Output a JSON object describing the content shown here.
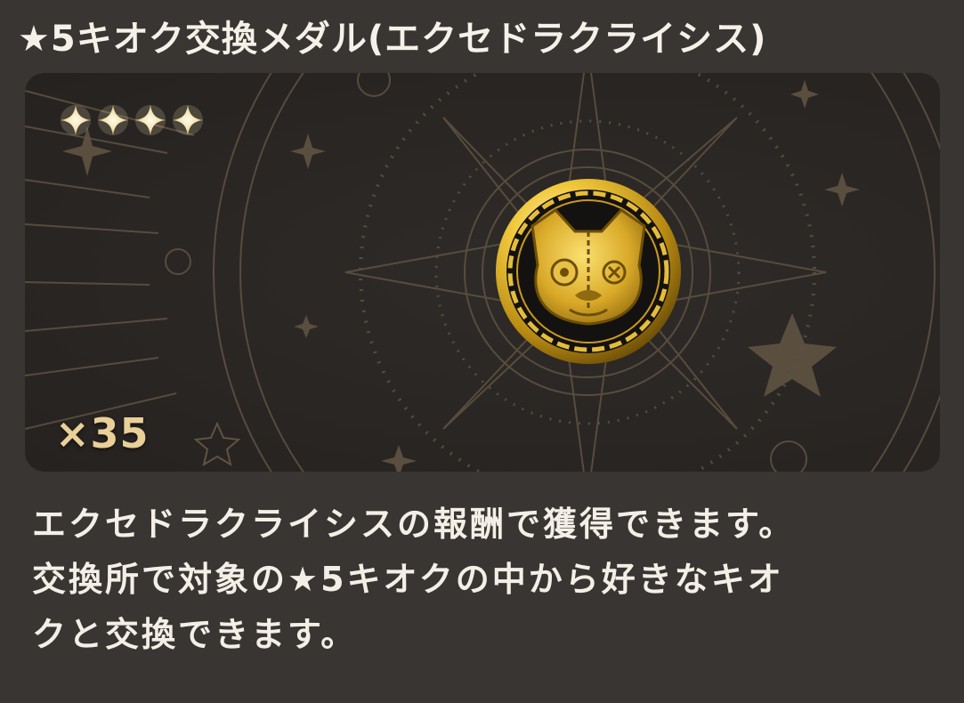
{
  "item": {
    "title": "★5キオク交換メダル(エクセドラクライシス)",
    "rarity_stars": 4,
    "quantity": "×35",
    "icon": "medal-cat-face-icon",
    "description_lines": [
      "エクセドラクライシスの報酬で獲得できます。",
      "交換所で対象の★5キオクの中から好きなキオ",
      "クと交換できます。"
    ]
  },
  "colors": {
    "background": "#383532",
    "panel": "#2a2624",
    "ornament": "#6e6048",
    "gold": "#e9cf98",
    "text": "#f4efe6"
  }
}
